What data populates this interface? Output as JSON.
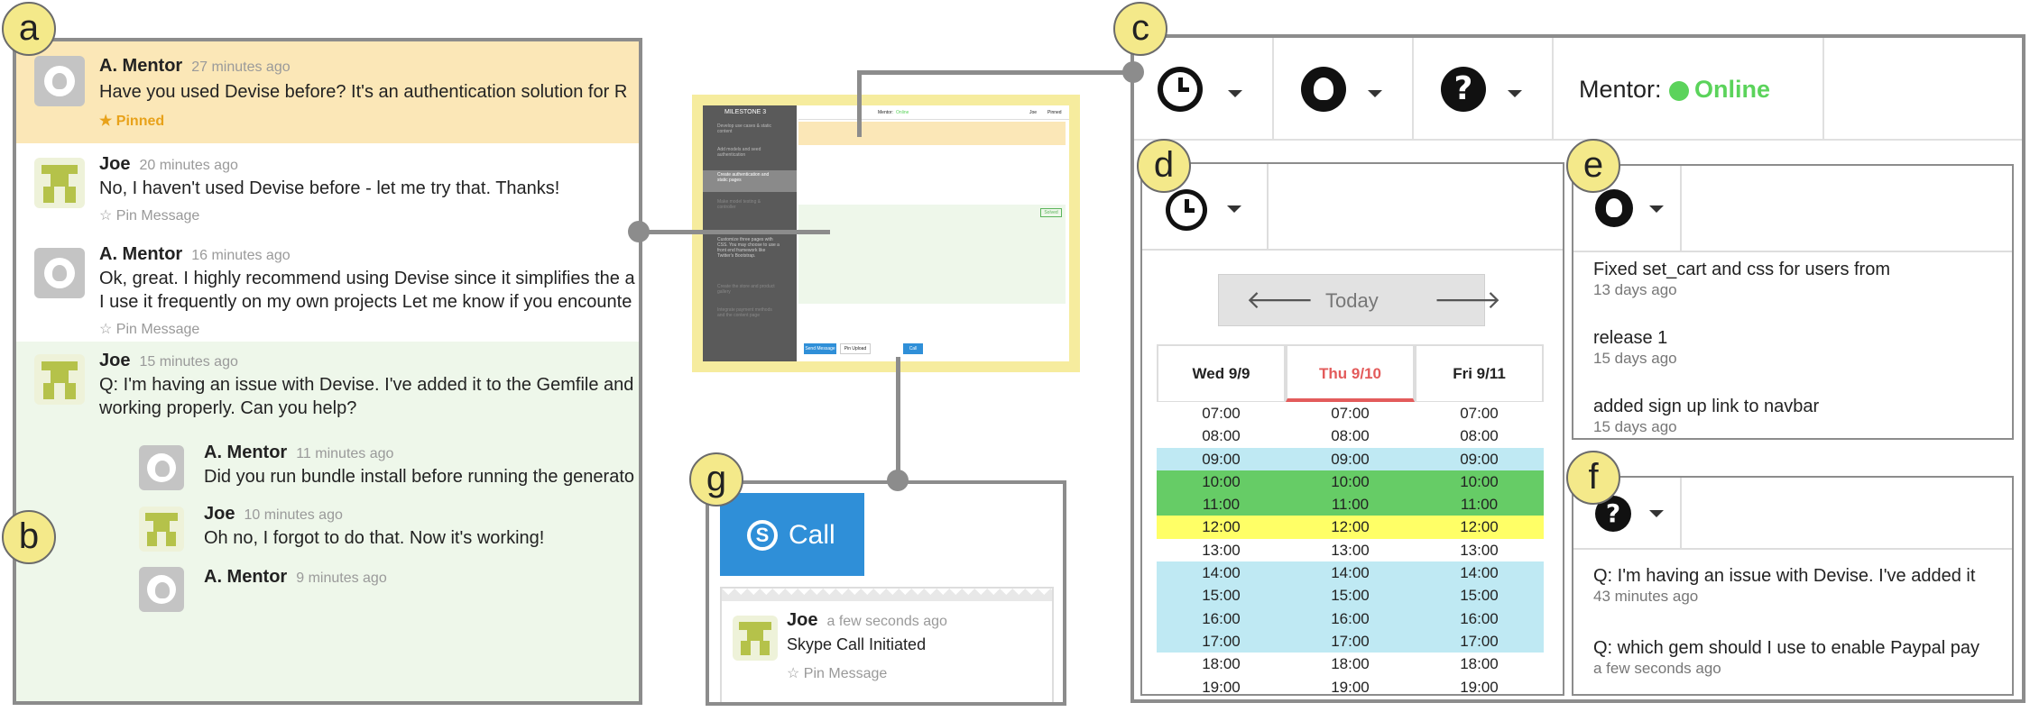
{
  "badges": {
    "a": "a",
    "b": "b",
    "c": "c",
    "d": "d",
    "e": "e",
    "f": "f",
    "g": "g"
  },
  "chat": {
    "messages": [
      {
        "name": "A. Mentor",
        "time": "27 minutes ago",
        "text": "Have you used Devise before? It's an authentication solution for R",
        "pin": "Pinned"
      },
      {
        "name": "Joe",
        "time": "20 minutes ago",
        "text": "No, I haven't used Devise before - let me try that. Thanks!",
        "pin": "Pin Message"
      },
      {
        "name": "A. Mentor",
        "time": "16 minutes ago",
        "text1": "Ok, great. I highly recommend using Devise since it simplifies the a",
        "text2": "I use it frequently on my own projects Let me know if you encounte",
        "pin": "Pin Message"
      },
      {
        "name": "Joe",
        "time": "15 minutes ago",
        "text1": "Q: I'm having an issue with Devise. I've added it to the Gemfile and",
        "text2": "working properly. Can you help?"
      },
      {
        "name": "A. Mentor",
        "time": "11 minutes ago",
        "text": "Did you run bundle install before running the generato"
      },
      {
        "name": "Joe",
        "time": "10 minutes ago",
        "text": "Oh no, I forgot to do that. Now it's working!"
      },
      {
        "name": "A. Mentor",
        "time": "9 minutes ago"
      }
    ]
  },
  "thumbnail": {
    "milestone": "MILESTONE 3",
    "sidebar_items": [
      "Develop use cases & static content",
      "Add models and seed authentication",
      "Create authentication and static pages",
      "Make model testing & controller",
      "Customize three pages with CSS. You may choose to use a front end framework like Twitter's Bootstrap.",
      "Create the store and product gallery",
      "Integrate payment methods and the content page"
    ],
    "mentor_label": "Mentor:",
    "online": "Online",
    "user": "Joe",
    "pinned": "Pinned",
    "send": "Send Message",
    "pin_upload": "Pin Upload",
    "call": "Call",
    "solved": "Solved"
  },
  "toolbar": {
    "mentor_label": "Mentor:",
    "status": "Online"
  },
  "calendar": {
    "today": "Today",
    "days": [
      "Wed 9/9",
      "Thu 9/10",
      "Fri 9/11"
    ],
    "times": [
      "07:00",
      "08:00",
      "09:00",
      "10:00",
      "11:00",
      "12:00",
      "13:00",
      "14:00",
      "15:00",
      "16:00",
      "17:00",
      "18:00",
      "19:00"
    ],
    "row_colors": [
      "#ffffff",
      "#ffffff",
      "#bfe9f3",
      "#66cc66",
      "#66cc66",
      "#ffff66",
      "#ffffff",
      "#bfe9f3",
      "#bfe9f3",
      "#bfe9f3",
      "#bfe9f3",
      "#ffffff",
      "#ffffff"
    ]
  },
  "commits": [
    {
      "title": "Fixed set_cart and css for users from",
      "age": "13 days ago"
    },
    {
      "title": "release 1",
      "age": "15 days ago"
    },
    {
      "title": "added sign up link to navbar",
      "age": "15 days ago"
    }
  ],
  "questions": [
    {
      "title": "Q: I'm having an issue with Devise. I've added it",
      "age": "43 minutes ago"
    },
    {
      "title": "Q: which gem should I use to enable Paypal pay",
      "age": "a few seconds ago"
    }
  ],
  "call_panel": {
    "call_label": "Call",
    "name": "Joe",
    "time": "a few seconds ago",
    "text": "Skype Call Initiated",
    "pin": "Pin Message"
  },
  "colors": {
    "online": "#5bd35b",
    "pinned_bg": "#fbe7b7",
    "thread_bg": "#eef7ea",
    "skype": "#2f8fd8",
    "accent_today": "#e35b5b"
  }
}
